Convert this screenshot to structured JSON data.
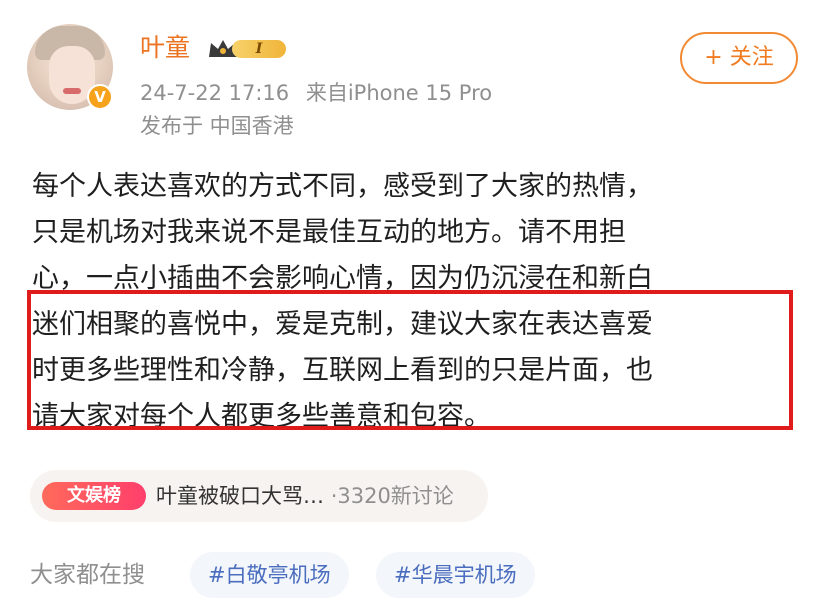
{
  "user": {
    "name": "叶童",
    "level_badge": "I",
    "verified_mark": "V"
  },
  "meta": {
    "timestamp": "24-7-22 17:16",
    "source": "来自iPhone 15 Pro",
    "location": "发布于 中国香港"
  },
  "actions": {
    "follow_label": "+ 关注"
  },
  "post": {
    "lines": [
      "每个人表达喜欢的方式不同，感受到了大家的热情，",
      "只是机场对我来说不是最佳互动的地方。请不用担",
      "心，一点小插曲不会影响心情，因为仍沉浸在和新白",
      "迷们相聚的喜悦中，爱是克制，建议大家在表达喜爱",
      "时更多些理性和冷静，互联网上看到的只是片面，也",
      "请大家对每个人都更多些善意和包容。"
    ]
  },
  "topic": {
    "tag": "文娱榜",
    "title": "叶童被破口大骂…",
    "count": "·3320新讨论"
  },
  "search": {
    "label": "大家都在搜",
    "tags": [
      "#白敬亭机场",
      "#华晨宇机场"
    ]
  },
  "colors": {
    "username": "#eb7321",
    "follow": "#f07b20",
    "highlight": "#e01b1b",
    "hashtag": "#4a6dbf"
  },
  "icons": {
    "crown": "crown-icon",
    "verified": "verified-badge-icon"
  }
}
